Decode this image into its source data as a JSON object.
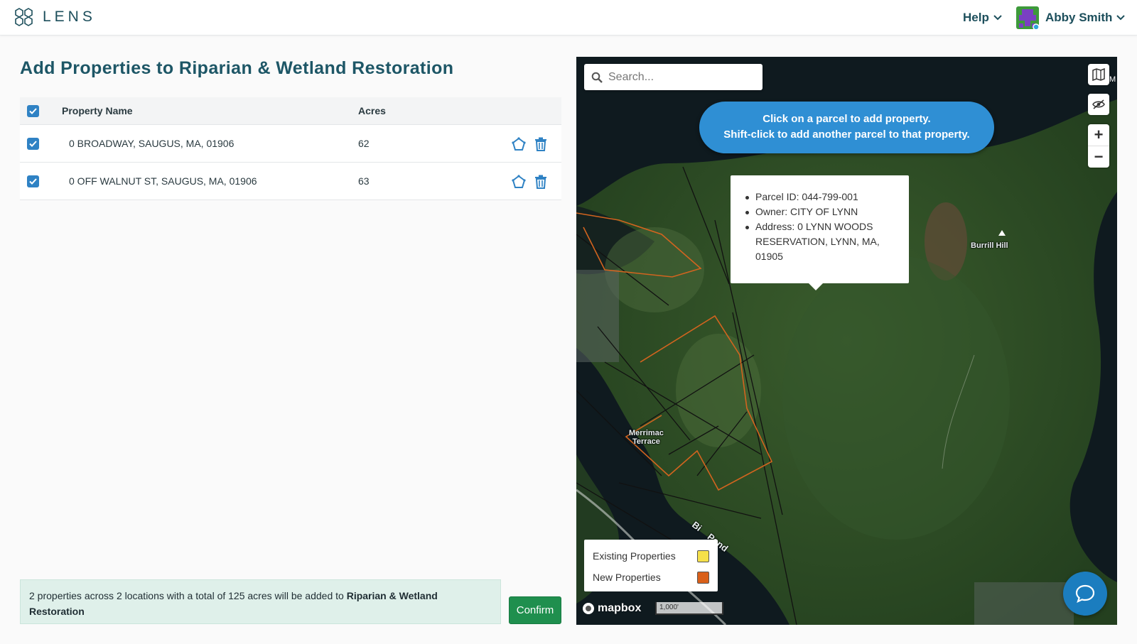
{
  "header": {
    "logo_text": "LENS",
    "help_label": "Help",
    "user_name": "Abby Smith"
  },
  "page": {
    "title": "Add Properties to Riparian & Wetland Restoration"
  },
  "table": {
    "col_name": "Property Name",
    "col_acres": "Acres",
    "rows": [
      {
        "name": "0 BROADWAY, SAUGUS, MA, 01906",
        "acres": "62",
        "checked": true
      },
      {
        "name": "0 OFF WALNUT ST, SAUGUS, MA, 01906",
        "acres": "63",
        "checked": true
      }
    ]
  },
  "summary": {
    "text": "2 properties across 2 locations with a total of 125 acres will be added to ",
    "program": "Riparian & Wetland Restoration"
  },
  "confirm_label": "Confirm",
  "map": {
    "search_placeholder": "Search...",
    "hint_line1": "Click on a parcel to add property.",
    "hint_line2": "Shift-click to add another parcel to that property.",
    "popup": {
      "parcel": "Parcel ID: 044-799-001",
      "owner": "Owner: CITY OF LYNN",
      "address": "Address: 0 LYNN WOODS RESERVATION, LYNN, MA, 01905"
    },
    "labels": {
      "burrill": "Burrill Hill",
      "merrimac1": "Merrimac",
      "merrimac2": "Terrace",
      "pond": "Bi    Pond",
      "edge": "M"
    },
    "legend": {
      "existing": "Existing Properties",
      "new": "New Properties",
      "existing_color": "#f5e04a",
      "new_color": "#d9601a"
    },
    "attribution": "mapbox",
    "scale": "1,000'",
    "zoom_in": "+",
    "zoom_out": "−"
  },
  "icons": {
    "logo": "hexagon-cluster-icon",
    "help_chevron": "chevron-down-icon",
    "user_chevron": "chevron-down-icon",
    "row_edit": "polygon-edit-icon",
    "row_delete": "trash-icon",
    "search": "search-icon",
    "basemap": "map-icon",
    "visibility": "eye-off-icon",
    "chat": "chat-bubble-icon"
  }
}
